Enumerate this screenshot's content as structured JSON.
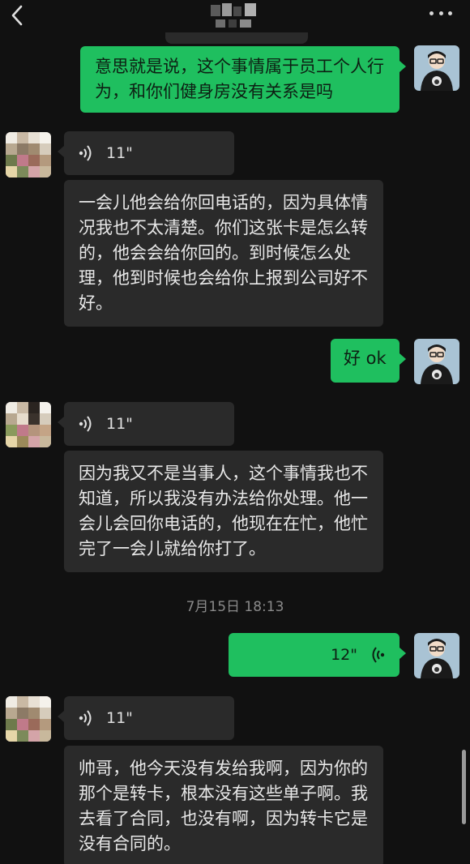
{
  "header": {
    "back_icon": "chevron-left-icon",
    "more_icon": "more-dots-icon"
  },
  "messages": [
    {
      "side": "out",
      "type": "text",
      "text": "意思就是说，这个事情属于员工个人行为，和你们健身房没有关系是吗"
    },
    {
      "side": "in",
      "type": "voice",
      "duration": "11\""
    },
    {
      "side": "in",
      "type": "text",
      "text": "一会儿他会给你回电话的，因为具体情况我也不太清楚。你们这张卡是怎么转的，他会会给你回的。到时候怎么处理，他到时候也会给你上报到公司好不好。"
    },
    {
      "side": "out",
      "type": "text",
      "text": "好 ok"
    },
    {
      "side": "in",
      "type": "voice",
      "duration": "11\""
    },
    {
      "side": "in",
      "type": "text",
      "text": "因为我又不是当事人，这个事情我也不知道，所以我没有办法给你处理。他一会儿会回你电话的，他现在在忙，他忙完了一会儿就给你打了。"
    },
    {
      "side": "system",
      "type": "timestamp",
      "text": "7月15日 18:13"
    },
    {
      "side": "out",
      "type": "voice",
      "duration": "12\""
    },
    {
      "side": "in",
      "type": "voice",
      "duration": "11\""
    },
    {
      "side": "in",
      "type": "text",
      "text": "帅哥，他今天没有发给我啊，因为你的那个是转卡，根本没有这些单子啊。我去看了合同，也没有啊，因为转卡它是没有合同的。"
    }
  ],
  "colors": {
    "background": "#111111",
    "outgoing_bubble": "#1fbf5f",
    "incoming_bubble": "#2a2a2a",
    "timestamp_text": "#8a8a8a"
  }
}
